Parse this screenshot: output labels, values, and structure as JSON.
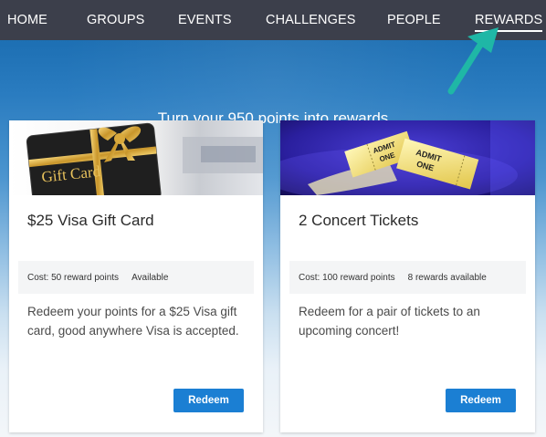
{
  "nav": {
    "items": [
      {
        "label": "HOME",
        "active": false
      },
      {
        "label": "GROUPS",
        "active": false
      },
      {
        "label": "EVENTS",
        "active": false
      },
      {
        "label": "CHALLENGES",
        "active": false
      },
      {
        "label": "PEOPLE",
        "active": false
      },
      {
        "label": "REWARDS",
        "active": true
      }
    ]
  },
  "hero": {
    "text": "Turn your 950 points into rewards"
  },
  "cards": [
    {
      "image": "gift-card-image",
      "image_text": "Gift Card",
      "title": "$25 Visa Gift Card",
      "cost": "Cost: 50 reward points",
      "availability": "Available",
      "description": "Redeem your points for a $25 Visa gift card, good anywhere Visa is accepted.",
      "button": "Redeem"
    },
    {
      "image": "concert-tickets-image",
      "image_text": "ADMIT ONE",
      "title": "2 Concert Tickets",
      "cost": "Cost: 100 reward points",
      "availability": "8 rewards available",
      "description": "Redeem for a pair of tickets to an upcoming concert!",
      "button": "Redeem"
    }
  ],
  "colors": {
    "nav_bg": "#3c3f4b",
    "hero_top": "#1d6fb3",
    "button": "#1b7fd3",
    "annotation_arrow": "#1fb7a6"
  }
}
